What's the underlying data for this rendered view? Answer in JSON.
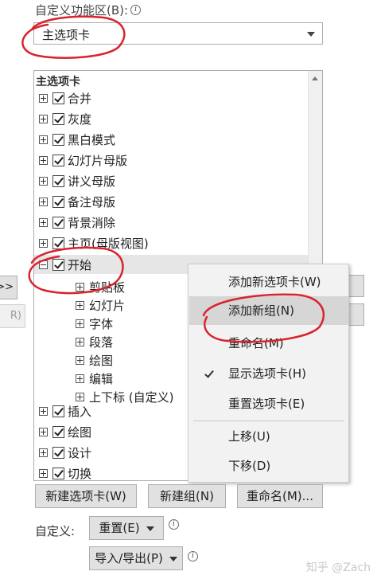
{
  "header": {
    "label": "自定义功能区(B):",
    "info_icon": "info-icon"
  },
  "dropdown": {
    "selected": "主选项卡"
  },
  "tree": {
    "title": "主选项卡",
    "items": [
      {
        "label": "合并",
        "expanded": false
      },
      {
        "label": "灰度",
        "expanded": false
      },
      {
        "label": "黑白模式",
        "expanded": false
      },
      {
        "label": "幻灯片母版",
        "expanded": false
      },
      {
        "label": "讲义母版",
        "expanded": false
      },
      {
        "label": "备注母版",
        "expanded": false
      },
      {
        "label": "背景消除",
        "expanded": false
      },
      {
        "label": "主页(母版视图)",
        "expanded": false
      },
      {
        "label": "开始",
        "expanded": true,
        "selected": true
      }
    ],
    "children": [
      "剪贴板",
      "幻灯片",
      "字体",
      "段落",
      "绘图",
      "编辑",
      "上下标 (自定义)"
    ],
    "items_after": [
      {
        "label": "插入",
        "expanded": false
      },
      {
        "label": "绘图",
        "expanded": false
      },
      {
        "label": "设计",
        "expanded": false
      },
      {
        "label": "切换",
        "expanded": false
      }
    ]
  },
  "left_buttons": {
    "add": ">>",
    "remove": "R)"
  },
  "context_menu": {
    "items": [
      {
        "label": "添加新选项卡(W)"
      },
      {
        "label": "添加新组(N)",
        "highlighted": true
      },
      {
        "label": "重命名(M)"
      },
      {
        "label": "显示选项卡(H)",
        "checked": true
      },
      {
        "label": "重置选项卡(E)"
      },
      {
        "label": "上移(U)"
      },
      {
        "label": "下移(D)"
      }
    ]
  },
  "buttons": {
    "new_tab": "新建选项卡(W)",
    "new_group": "新建组(N)",
    "rename": "重命名(M)...",
    "reset": "重置(E)",
    "import_export": "导入/导出(P)"
  },
  "customize_label": "自定义:",
  "watermark": "知乎 @Zach",
  "colors": {
    "annotation": "#d9232d",
    "menu_highlight": "#d6d6d6",
    "selected_row": "#e6e6e6"
  }
}
